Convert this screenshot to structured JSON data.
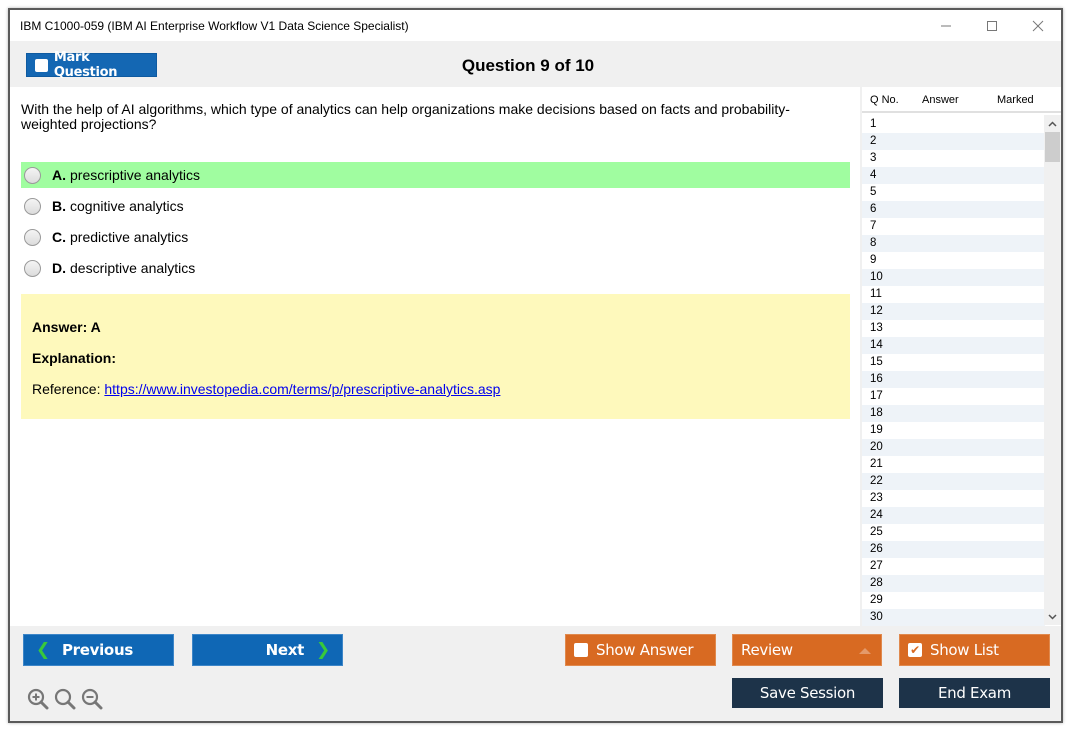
{
  "window": {
    "title": "IBM C1000-059 (IBM AI Enterprise Workflow V1 Data Science Specialist)",
    "controls": [
      "minimize",
      "maximize",
      "close"
    ]
  },
  "topbar": {
    "mark_label": "Mark Question",
    "mark_checked": false,
    "counter": "Question 9 of 10",
    "current": 9,
    "total": 10
  },
  "question": {
    "text": "With the help of AI algorithms, which type of analytics can help organizations make decisions based on facts and probability-weighted projections?",
    "options": [
      {
        "letter": "A.",
        "text": "prescriptive analytics",
        "highlighted": true
      },
      {
        "letter": "B.",
        "text": "cognitive analytics",
        "highlighted": false
      },
      {
        "letter": "C.",
        "text": "predictive analytics",
        "highlighted": false
      },
      {
        "letter": "D.",
        "text": "descriptive analytics",
        "highlighted": false
      }
    ]
  },
  "answer_panel": {
    "answer": "Answer: A",
    "explanation_label": "Explanation:",
    "reference_label": "Reference: ",
    "reference_link": "https://www.investopedia.com/terms/p/prescriptive-analytics.asp"
  },
  "question_list": {
    "headers": {
      "qno": "Q No.",
      "answer": "Answer",
      "marked": "Marked"
    },
    "rows": [
      "1",
      "2",
      "3",
      "4",
      "5",
      "6",
      "7",
      "8",
      "9",
      "10",
      "11",
      "12",
      "13",
      "14",
      "15",
      "16",
      "17",
      "18",
      "19",
      "20",
      "21",
      "22",
      "23",
      "24",
      "25",
      "26",
      "27",
      "28",
      "29",
      "30"
    ]
  },
  "bottombar": {
    "previous_label": "Previous",
    "next_label": "Next",
    "show_answer_label": "Show Answer",
    "show_answer_checked": false,
    "review_label": "Review",
    "show_list_label": "Show List",
    "show_list_checked": true,
    "save_session_label": "Save Session",
    "end_exam_label": "End Exam",
    "zoom_icons": [
      "zoom-in-icon",
      "zoom-reset-icon",
      "zoom-out-icon"
    ]
  },
  "colors": {
    "primary_blue": "#0f67b5",
    "orange": "#d86a22",
    "dark_navy": "#1d3349",
    "correct_green": "#a0fda0",
    "answer_yellow": "#fef9bc",
    "chevron_green": "#38c83b"
  }
}
